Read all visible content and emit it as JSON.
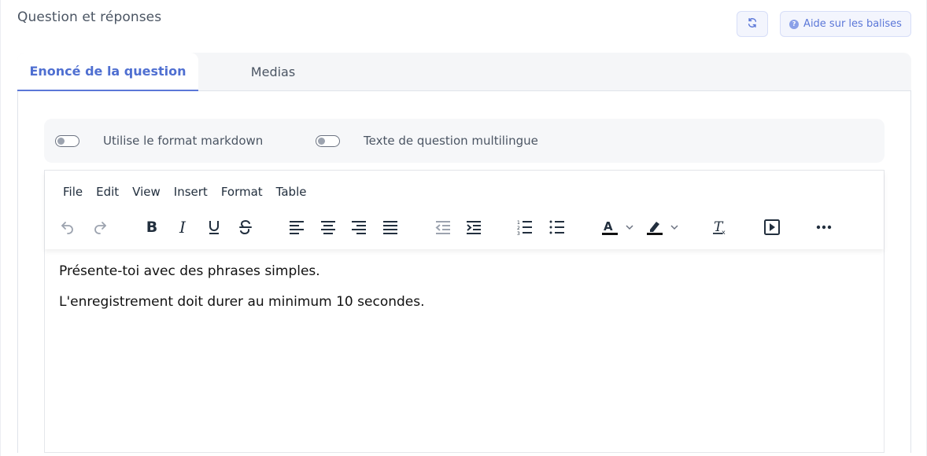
{
  "section": {
    "title": "Question et réponses"
  },
  "actions": {
    "refresh_icon": "refresh-icon",
    "help_label": "Aide sur les balises",
    "help_icon": "question-circle-icon"
  },
  "tabs": [
    {
      "label": "Enoncé de la question",
      "active": true
    },
    {
      "label": "Medias",
      "active": false
    }
  ],
  "options": {
    "markdown": {
      "label": "Utilise le format markdown",
      "on": false
    },
    "multilingual": {
      "label": "Texte de question multilingue",
      "on": false
    }
  },
  "editor": {
    "menu": [
      "File",
      "Edit",
      "View",
      "Insert",
      "Format",
      "Table"
    ],
    "toolbar": [
      "undo-icon",
      "redo-icon",
      "bold-icon",
      "italic-icon",
      "underline-icon",
      "strikethrough-icon",
      "align-left-icon",
      "align-center-icon",
      "align-right-icon",
      "align-justify-icon",
      "outdent-icon",
      "indent-icon",
      "numbered-list-icon",
      "bullet-list-icon",
      "text-color-icon",
      "highlight-color-icon",
      "clear-formatting-icon",
      "media-icon",
      "more-icon"
    ],
    "paragraphs": [
      "Présente-toi avec des phrases simples.",
      "L'enregistrement doit durer au minimum 10 secondes."
    ]
  },
  "colors": {
    "accent": "#4f6fd1",
    "text": "#4b5563"
  }
}
